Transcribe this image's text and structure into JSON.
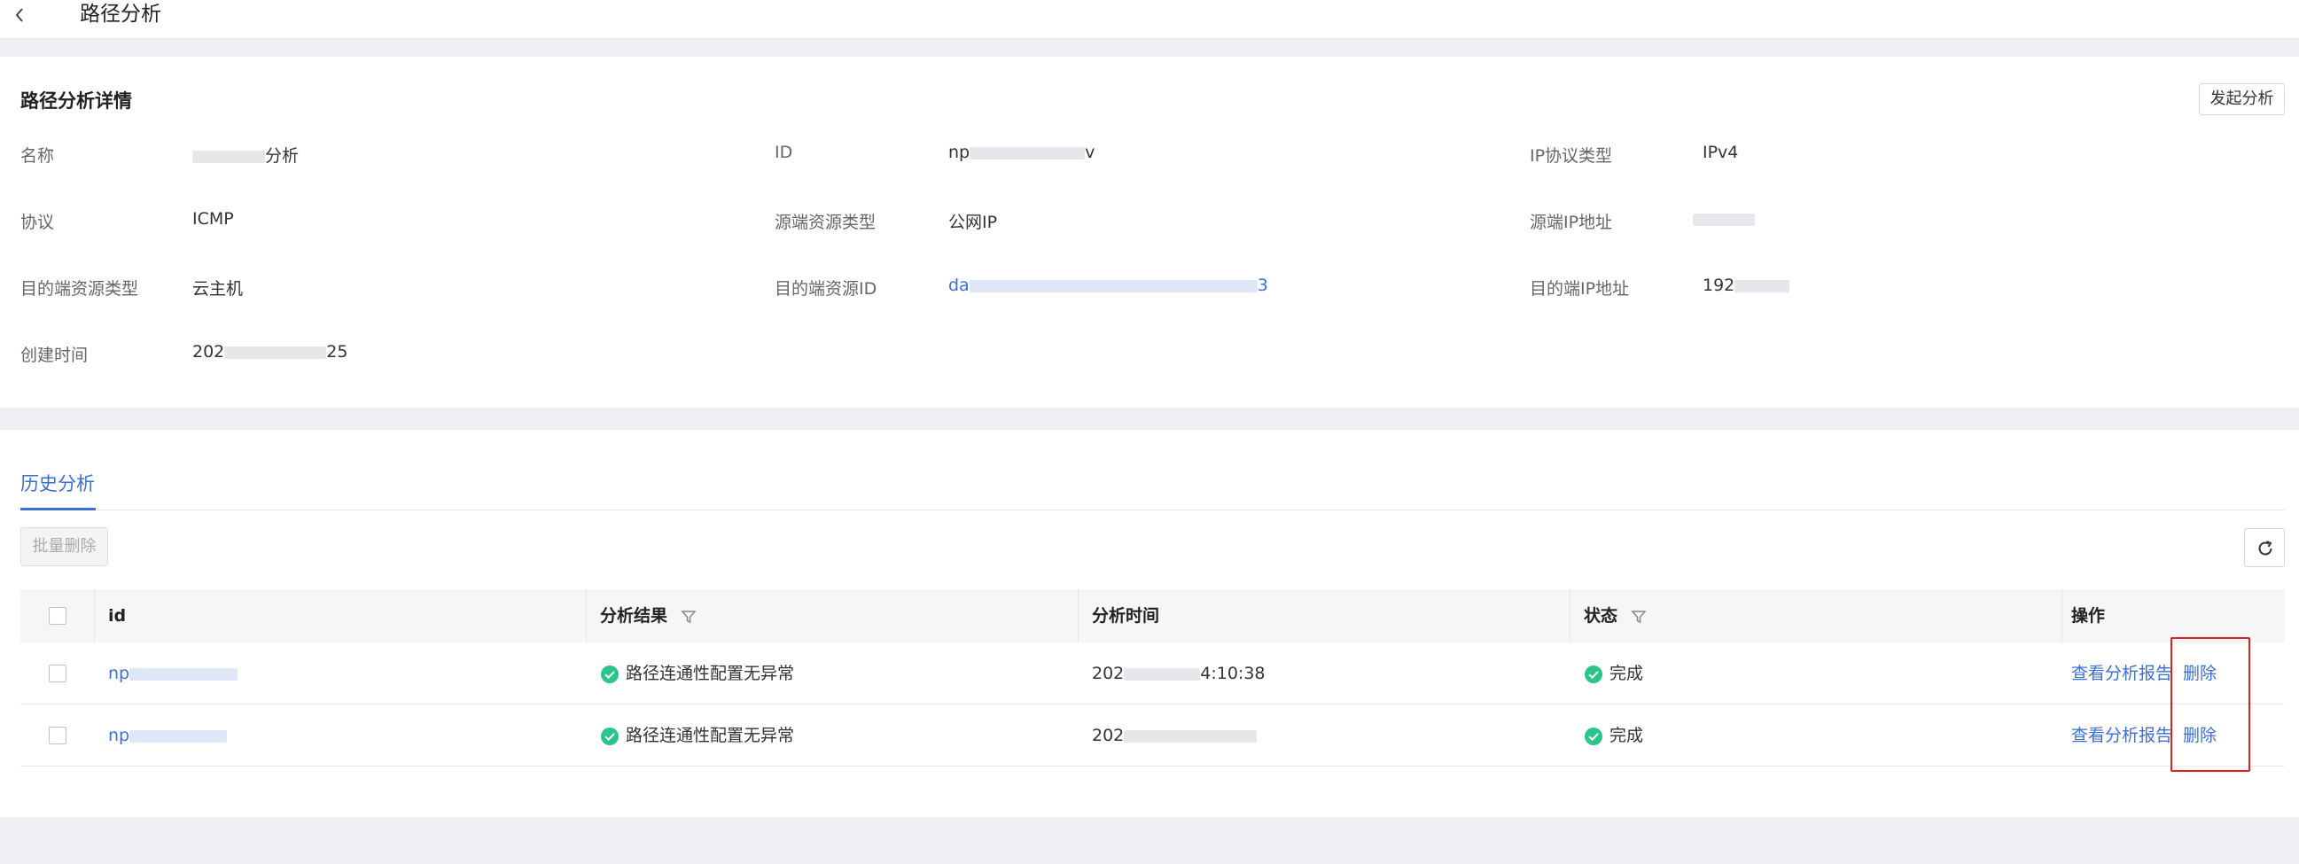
{
  "header": {
    "title": "路径分析"
  },
  "detail": {
    "title": "路径分析详情",
    "start_button": "发起分析",
    "fields": {
      "name": {
        "label": "名称",
        "value_suffix": "分析"
      },
      "id": {
        "label": "ID",
        "value_prefix": "np",
        "value_suffix": "v"
      },
      "ip_protocol_type": {
        "label": "IP协议类型",
        "value": "IPv4"
      },
      "protocol": {
        "label": "协议",
        "value": "ICMP"
      },
      "source_resource_type": {
        "label": "源端资源类型",
        "value": "公网IP"
      },
      "source_ip": {
        "label": "源端IP地址"
      },
      "dest_resource_type": {
        "label": "目的端资源类型",
        "value": "云主机"
      },
      "dest_resource_id": {
        "label": "目的端资源ID",
        "value_prefix": "da",
        "value_suffix": "3"
      },
      "dest_ip": {
        "label": "目的端IP地址",
        "value_prefix": "192"
      },
      "created_time": {
        "label": "创建时间",
        "value_prefix": "202",
        "value_suffix": "25"
      }
    }
  },
  "history": {
    "tab_label": "历史分析",
    "batch_delete": "批量删除",
    "columns": {
      "id": "id",
      "result": "分析结果",
      "time": "分析时间",
      "status": "状态",
      "actions": "操作"
    },
    "rows": [
      {
        "id_prefix": "np",
        "result": "路径连通性配置无异常",
        "time_prefix": "202",
        "time_suffix": "4:10:38",
        "status": "完成",
        "view_report": "查看分析报告",
        "delete": "删除"
      },
      {
        "id_prefix": "np",
        "result": "路径连通性配置无异常",
        "time_prefix": "202",
        "time_suffix": "",
        "status": "完成",
        "view_report": "查看分析报告",
        "delete": "删除"
      }
    ]
  },
  "colors": {
    "accent": "#3a6fd8",
    "success": "#2bc48a",
    "highlight": "#e02020"
  }
}
